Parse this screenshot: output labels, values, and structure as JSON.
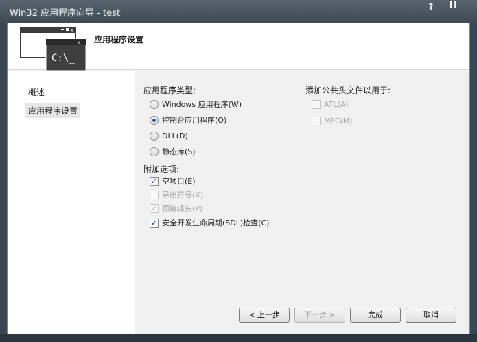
{
  "window": {
    "title": "Win32 应用程序向导 - test",
    "help_label": "?",
    "sys_label": "II"
  },
  "header": {
    "title": "应用程序设置",
    "icon_text": "C:\\_"
  },
  "nav": {
    "items": [
      {
        "label": "概述"
      },
      {
        "label": "应用程序设置"
      }
    ]
  },
  "app_type": {
    "label": "应用程序类型:",
    "options": [
      {
        "label": "Windows 应用程序(W)",
        "selected": false
      },
      {
        "label": "控制台应用程序(O)",
        "selected": true
      },
      {
        "label": "DLL(D)",
        "selected": false
      },
      {
        "label": "静态库(S)",
        "selected": false
      }
    ]
  },
  "extra_options": {
    "label": "附加选项:",
    "options": [
      {
        "label": "空项目(E)",
        "checked": true,
        "enabled": true
      },
      {
        "label": "导出符号(X)",
        "checked": false,
        "enabled": false
      },
      {
        "label": "预编译头(P)",
        "checked": true,
        "enabled": false
      },
      {
        "label": "安全开发生命周期(SDL)检查(C)",
        "checked": true,
        "enabled": true
      }
    ]
  },
  "common_headers": {
    "label": "添加公共头文件以用于:",
    "options": [
      {
        "label": "ATL(A)",
        "checked": false,
        "enabled": false
      },
      {
        "label": "MFC(M)",
        "checked": false,
        "enabled": false
      }
    ]
  },
  "buttons": {
    "prev": "< 上一步",
    "next": "下一步 >",
    "finish": "完成",
    "cancel": "取消"
  },
  "colors": {
    "chrome": "#4a5561",
    "dialog_bg": "#f0f0f0",
    "accent": "#2a5a9e"
  }
}
